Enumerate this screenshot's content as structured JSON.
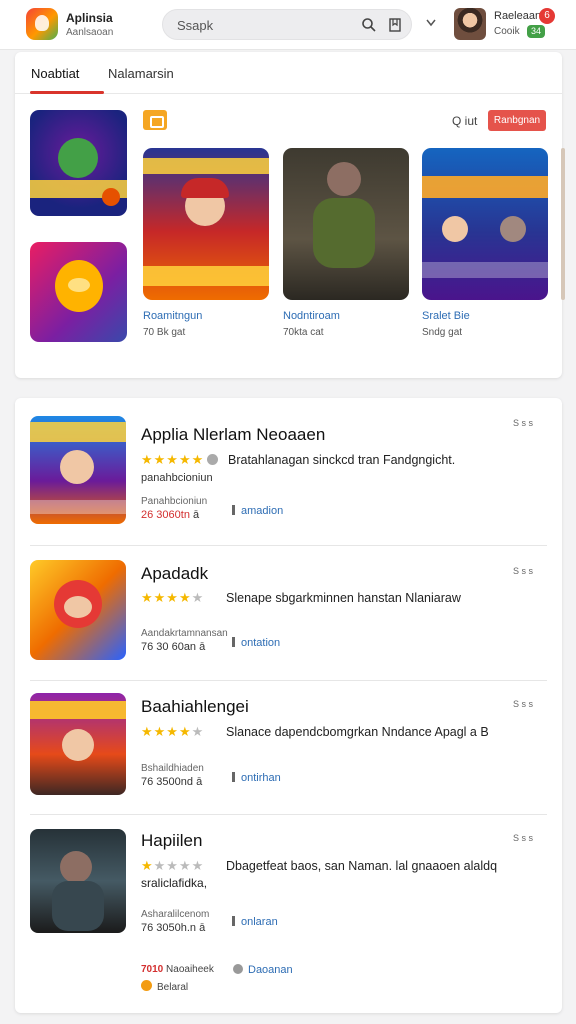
{
  "header": {
    "app_title": "Aplinsia",
    "app_subtitle": "Aanlsaoan",
    "search_placeholder": "Ssapk",
    "user_name": "Raeleaan",
    "user_status": "Cooik",
    "notif_count": "6",
    "green_badge": "34"
  },
  "tabs": [
    {
      "label": "Noabtiat",
      "active": true
    },
    {
      "label": "Nalamarsin",
      "active": false
    }
  ],
  "featured": {
    "q_label": "Q iut",
    "action_label": "Ranbgnan",
    "games": [
      {
        "name": "Roamitngun",
        "meta": "70 Bk gat"
      },
      {
        "name": "Nodntiroam",
        "meta": "70kta cat"
      },
      {
        "name": "Sralet Bie",
        "meta": "Sndg gat"
      }
    ]
  },
  "list": [
    {
      "title": "Applia Nlerlam Neoaaen",
      "stars": 5,
      "description": "Bratahlanagan sinckcd tran Fandgngicht.",
      "extra": "panahbcioniun",
      "small": "Panahbcioniun",
      "price": "26 3060tn",
      "price_suffix": "ā",
      "link": "amadion",
      "corner": "S s s"
    },
    {
      "title": "Apadadk",
      "stars": 4,
      "description": "Slenape sbgarkminnen hanstan Nlaniaraw",
      "small": "Aandakrtamnansan",
      "price": "76 30 60an",
      "price_suffix": "ā",
      "link": "ontation",
      "corner": "S s s"
    },
    {
      "title": "Baahiahlengei",
      "stars": 4,
      "description": "Slanace dapendcbomgrkan Nndance Apagl a B",
      "small": "Bshaildhiaden",
      "price": "76 3500nd",
      "price_suffix": "ā",
      "link": "ontirhan",
      "corner": "S s s"
    },
    {
      "title": "Hapiilen",
      "stars": 1,
      "description": "Dbagetfeat baos, san Naman. lal gnaaoen alaldq",
      "description2": "sraliclafidka,",
      "small": "Asharalilcenom",
      "price": "76 3050h.n",
      "price_suffix": "ā",
      "link": "onlaran",
      "corner": "S s s"
    }
  ],
  "footer": {
    "price_red": "7010",
    "price_text": "Naoaiheek",
    "link": "Daoanan",
    "note": "Belaral"
  },
  "colors": {
    "accent_red": "#e5534b",
    "link_blue": "#2e6db4",
    "star_yellow": "#f5b800"
  }
}
